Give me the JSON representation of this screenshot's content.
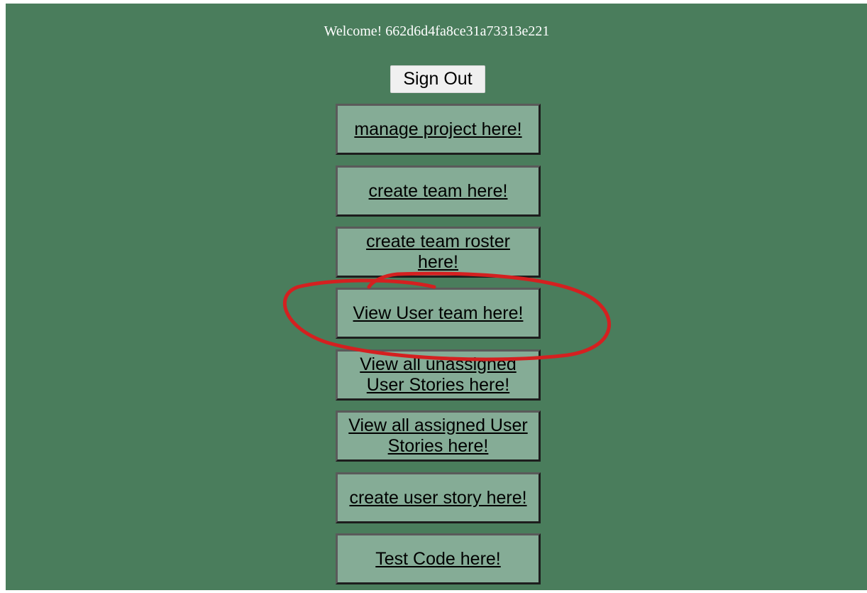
{
  "header": {
    "welcome_text": "Welcome! 662d6d4fa8ce31a73313e221"
  },
  "signout": {
    "label": "Sign Out"
  },
  "nav_links": [
    {
      "label": "manage project here!"
    },
    {
      "label": "create team here!"
    },
    {
      "label": "create team roster here!"
    },
    {
      "label": "View User team here!"
    },
    {
      "label": "View all unassigned User Stories here!"
    },
    {
      "label": "View all assigned User Stories here!"
    },
    {
      "label": "create user story here!"
    },
    {
      "label": "Test Code here!"
    }
  ],
  "colors": {
    "page_background": "#4a7d5c",
    "link_box_background": "#85ac96",
    "annotation_stroke": "#d42020"
  }
}
